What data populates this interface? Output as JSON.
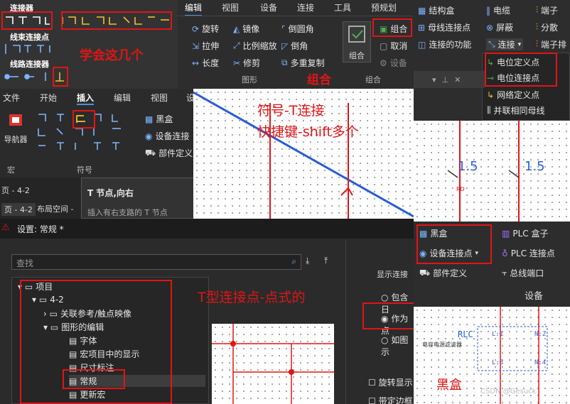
{
  "connector_panel": {
    "header_connectors": "连接器",
    "header_bus": "线束连接点",
    "header_line": "线路连接器"
  },
  "learn_label": "学会这几个",
  "ribbon_top": {
    "tabs": [
      "编辑",
      "视图",
      "设备",
      "连接",
      "工具",
      "预规划"
    ],
    "tools": [
      "旋转",
      "镜像",
      "倒圆角",
      "拉伸",
      "比例缩放",
      "倒角",
      "长度",
      "修剪",
      "多重复制"
    ],
    "group_graphics": "图形",
    "group_btn": "组合",
    "group_label": "组合",
    "highlight_group": "组合",
    "cancel": "取消",
    "device": "设备"
  },
  "right_top": {
    "items": [
      "结构盒",
      "母线连接点",
      "连接的功能"
    ],
    "items2": [
      "电缆",
      "屏蔽",
      "连接"
    ],
    "items3": [
      "端子",
      "分散",
      "端子排"
    ],
    "menu": [
      "电位定义点",
      "电位连接点",
      "网络定义点",
      "并联相同母线"
    ]
  },
  "ribbon_main": {
    "tabs": [
      "文件",
      "开始",
      "插入",
      "编辑",
      "视图",
      "设"
    ],
    "nav": "导航器",
    "macro": "宏",
    "symbol": "符号",
    "blackbox": "黑盒",
    "device_conn": "设备连接",
    "part_def": "部件定义"
  },
  "tooltip": {
    "title": "T 节点,向右",
    "desc": "插入有右支路的 T 节点"
  },
  "page_items": [
    "页 - 4-2",
    "页 - 4-2",
    "布局空间 -"
  ],
  "canvas_annot": {
    "line1": "符号-T连接",
    "line2": "快捷键-shift多个"
  },
  "dim": {
    "v1": "1.5",
    "v2": "1.5",
    "rd": "RD"
  },
  "settings": {
    "title": "设置: 常规 *",
    "search_placeholder": "查找",
    "tree": [
      "项目",
      "4-2",
      "关联参考/触点映像",
      "图形的编辑",
      "字体",
      "宏项目中的显示",
      "尺寸标注",
      "常规",
      "更新宏",
      "…"
    ],
    "annot": "T型连接点-点式的",
    "right_label": "显示连接",
    "radio1": "包含日",
    "radio2": "作为点",
    "radio3": "如图示",
    "chk1": "旋转显示",
    "chk2": "带定边框"
  },
  "bottom_right": {
    "blackbox": "黑盒",
    "plc_box": "PLC 盒子",
    "device_conn": "设备连接点",
    "plc_conn": "PLC 连接点",
    "part_def": "部件定义",
    "bus_port": "总线端口",
    "device": "设备",
    "blackbox_label": "黑盒",
    "plc_tag": "RLC",
    "filter": "电容电源滤波器",
    "cells": [
      "L:1",
      "N:2",
      "L:3",
      "N:4"
    ],
    "watermark": "CSDN @Gesuck"
  },
  "colors": {
    "red": "#e01515",
    "blue": "#2a5dd6",
    "dark": "#2b2b2b"
  }
}
